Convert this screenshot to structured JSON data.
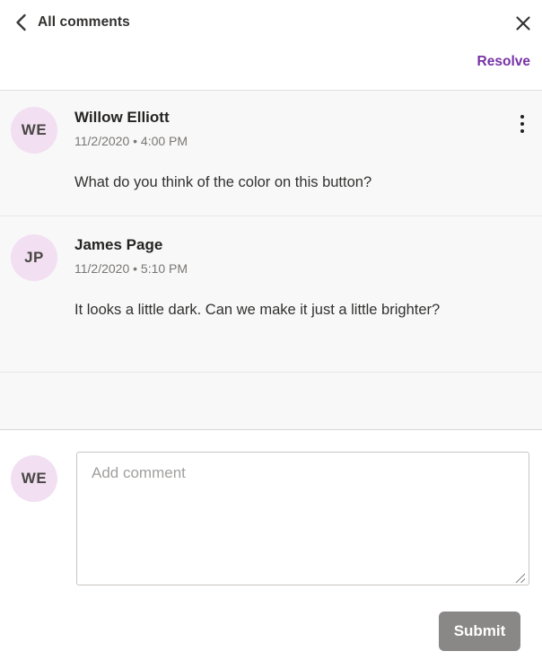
{
  "colors": {
    "accent": "#7632A5",
    "avatar-bg": "#F2DFF2",
    "avatar-text": "#484644",
    "submit-bg": "#8A8886"
  },
  "icons": {
    "back": "chevron-left",
    "close": "x",
    "comment_menu": "kebab-vertical",
    "textarea_corner": "resize-grip"
  },
  "header": {
    "title": "All comments",
    "resolve_label": "Resolve"
  },
  "comments": [
    {
      "initials": "WE",
      "author": "Willow Elliott",
      "timestamp": "11/2/2020 • 4:00 PM",
      "text": "What do you think of the color on this button?"
    },
    {
      "initials": "JP",
      "author": "James Page",
      "timestamp": "11/2/2020 • 5:10 PM",
      "text": "It looks a little dark. Can we make it just a little brighter?"
    }
  ],
  "composer": {
    "initials": "WE",
    "placeholder": "Add comment",
    "value": "",
    "submit_label": "Submit"
  }
}
